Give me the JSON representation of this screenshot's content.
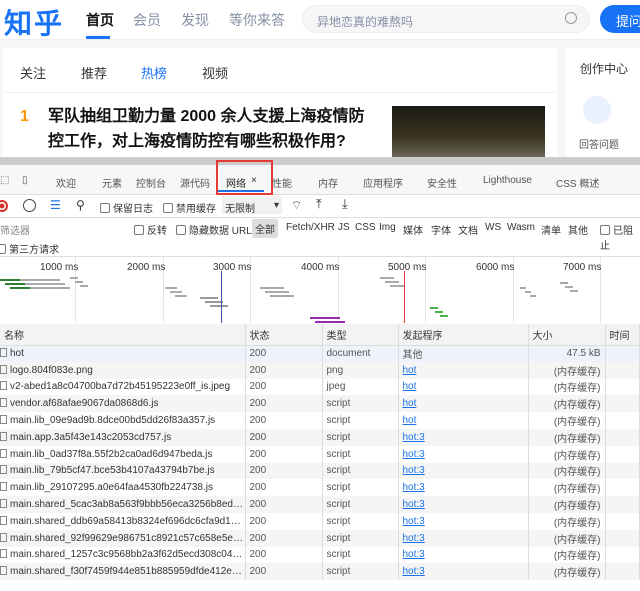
{
  "header": {
    "logo": "知乎",
    "nav": [
      "首页",
      "会员",
      "发现",
      "等你来答"
    ],
    "search_placeholder": "异地恋真的难熬吗",
    "ask_button": "提问"
  },
  "feed": {
    "tabs": [
      "关注",
      "推荐",
      "热榜",
      "视频"
    ],
    "active_tab": "热榜",
    "item": {
      "rank": "1",
      "title": "军队抽组卫勤力量 2000 余人支援上海疫情防控工作，对上海疫情防控有哪些积极作用?"
    }
  },
  "sidebar": {
    "title": "创作中心",
    "answer": "回答问题"
  },
  "devtools": {
    "tabs": [
      "欢迎",
      "元素",
      "控制台",
      "源代码",
      "网络",
      "性能",
      "内存",
      "应用程序",
      "安全性",
      "Lighthouse",
      "CSS 概述"
    ],
    "active_tab": "网络",
    "toolbar": {
      "preserve_log": "保留日志",
      "disable_cache": "禁用缓存",
      "throttle": "无限制"
    },
    "filter": {
      "placeholder": "筛选器",
      "invert": "反转",
      "hide_data_url": "隐藏数据 URL",
      "types": [
        "全部",
        "Fetch/XHR",
        "JS",
        "CSS",
        "Img",
        "媒体",
        "字体",
        "文档",
        "WS",
        "Wasm",
        "清单",
        "其他"
      ],
      "blocked": "已阻止",
      "third_party": "第三方请求"
    },
    "overview_ticks": [
      "1000 ms",
      "2000 ms",
      "3000 ms",
      "4000 ms",
      "5000 ms",
      "6000 ms",
      "7000 ms"
    ],
    "columns": [
      "名称",
      "状态",
      "类型",
      "发起程序",
      "大小",
      "时间"
    ],
    "rows": [
      [
        "hot",
        "200",
        "document",
        "其他",
        "47.5 kB"
      ],
      [
        "logo.804f083e.png",
        "200",
        "png",
        "hot",
        "(内存缓存)"
      ],
      [
        "v2-abed1a8c04700ba7d72b45195223e0ff_is.jpeg",
        "200",
        "jpeg",
        "hot",
        "(内存缓存)"
      ],
      [
        "vendor.af68afae9067da0868d6.js",
        "200",
        "script",
        "hot",
        "(内存缓存)"
      ],
      [
        "main.lib_09e9ad9b.8dce00bd5dd26f83a357.js",
        "200",
        "script",
        "hot",
        "(内存缓存)"
      ],
      [
        "main.app.3a5f43e143c2053cd757.js",
        "200",
        "script",
        "hot:3",
        "(内存缓存)"
      ],
      [
        "main.lib_0ad37f8a.55f2b2ca0ad6d947beda.js",
        "200",
        "script",
        "hot:3",
        "(内存缓存)"
      ],
      [
        "main.lib_79b5cf47.bce53b4107a43794b7be.js",
        "200",
        "script",
        "hot:3",
        "(内存缓存)"
      ],
      [
        "main.lib_29107295.a0e64faa4530fb224738.js",
        "200",
        "script",
        "hot:3",
        "(内存缓存)"
      ],
      [
        "main.shared_5cac3ab8a563f9bbb56eca3256b8ed78b...",
        "200",
        "script",
        "hot:3",
        "(内存缓存)"
      ],
      [
        "main.shared_ddb69a58413b8324ef696dc6cfa9d1ea4c...",
        "200",
        "script",
        "hot:3",
        "(内存缓存)"
      ],
      [
        "main.shared_92f99629e986751c8921c57c658e5e3ebe...",
        "200",
        "script",
        "hot:3",
        "(内存缓存)"
      ],
      [
        "main.shared_1257c3c9568bb2a3f62d5ecd308c048e4...",
        "200",
        "script",
        "hot:3",
        "(内存缓存)"
      ],
      [
        "main.shared_f30f7459f944e851b885959dfde412e92f3...",
        "200",
        "script",
        "hot:3",
        "(内存缓存)"
      ]
    ],
    "colors": {
      "accent": "#1a73e8",
      "highlight_box": "#e53935",
      "record": "#d93025"
    }
  }
}
